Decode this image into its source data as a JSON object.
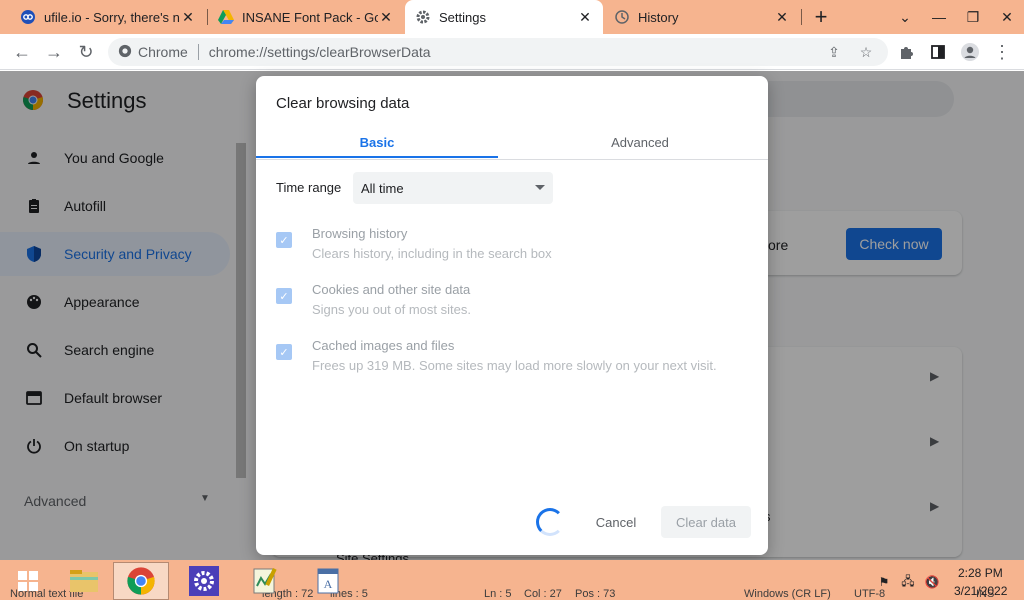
{
  "browser": {
    "tabs": [
      {
        "title": "ufile.io - Sorry, there's no",
        "icon": "ufile-icon",
        "active": false
      },
      {
        "title": "INSANE Font Pack - Goo",
        "icon": "google-drive-icon",
        "active": false
      },
      {
        "title": "Settings",
        "icon": "gear-icon",
        "active": true
      },
      {
        "title": "History",
        "icon": "history-icon",
        "active": false
      }
    ],
    "new_tab_label": "+",
    "window_controls": {
      "dropdown": "⌄",
      "minimize": "—",
      "restore": "❐",
      "close": "✕"
    },
    "address": {
      "scheme_label": "Chrome",
      "url": "chrome://settings/clearBrowserData"
    }
  },
  "settings": {
    "title": "Settings",
    "nav": [
      {
        "label": "You and Google",
        "icon": "person-icon"
      },
      {
        "label": "Autofill",
        "icon": "clipboard-icon"
      },
      {
        "label": "Security and Privacy",
        "icon": "shield-icon",
        "selected": true
      },
      {
        "label": "Appearance",
        "icon": "palette-icon"
      },
      {
        "label": "Search engine",
        "icon": "search-icon"
      },
      {
        "label": "Default browser",
        "icon": "browser-icon"
      },
      {
        "label": "On startup",
        "icon": "power-icon"
      }
    ],
    "advanced_label": "Advanced",
    "safety_check_button": "Check now",
    "card_more_text": "ore",
    "site_settings_label": "Site Settings",
    "stub_s_text": "s"
  },
  "dialog": {
    "title": "Clear browsing data",
    "tabs": {
      "basic": "Basic",
      "advanced": "Advanced"
    },
    "time_range": {
      "label": "Time range",
      "value": "All time"
    },
    "options": [
      {
        "title": "Browsing history",
        "desc": "Clears history, including in the search box",
        "checked": true
      },
      {
        "title": "Cookies and other site data",
        "desc": "Signs you out of most sites.",
        "checked": true
      },
      {
        "title": "Cached images and files",
        "desc": "Frees up 319 MB. Some sites may load more slowly on your next visit.",
        "checked": true
      }
    ],
    "cancel_label": "Cancel",
    "clear_label": "Clear data"
  },
  "taskbar": {
    "status": {
      "left": "Normal text file",
      "length": "length : 72",
      "lines": "lines : 5",
      "ln": "Ln : 5",
      "col": "Col : 27",
      "pos": "Pos : 73",
      "eol": "Windows (CR LF)",
      "enc": "UTF-8",
      "ins": "INS"
    },
    "clock": {
      "time": "2:28 PM",
      "date": "3/21/2022"
    }
  },
  "colors": {
    "accent": "#1a73e8",
    "chrome_frame": "#f6b48f"
  }
}
